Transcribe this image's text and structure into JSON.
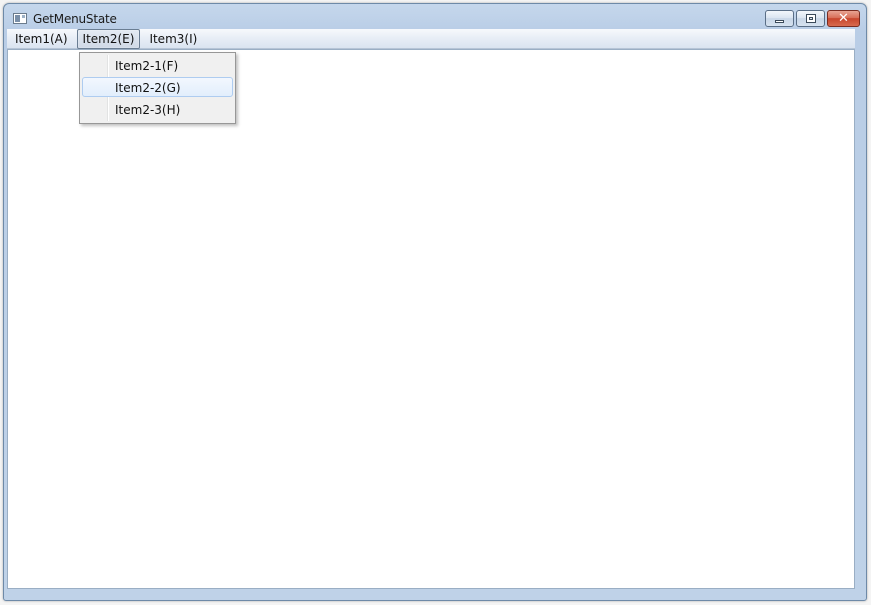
{
  "window": {
    "title": "GetMenuState",
    "minimize_icon": "minimize-icon",
    "maximize_icon": "maximize-icon",
    "close_icon": "close-icon",
    "close_glyph": "✕"
  },
  "menubar": {
    "items": [
      {
        "label": "Item1(A)"
      },
      {
        "label": "Item2(E)",
        "open": true
      },
      {
        "label": "Item3(I)"
      }
    ]
  },
  "dropdown": {
    "items": [
      {
        "label": "Item2-1(F)"
      },
      {
        "label": "Item2-2(G)",
        "highlighted": true
      },
      {
        "label": "Item2-3(H)"
      }
    ]
  },
  "colors": {
    "titlebar": "#c5d7ec",
    "close_button": "#c8452c",
    "highlight": "#e2eefc"
  }
}
